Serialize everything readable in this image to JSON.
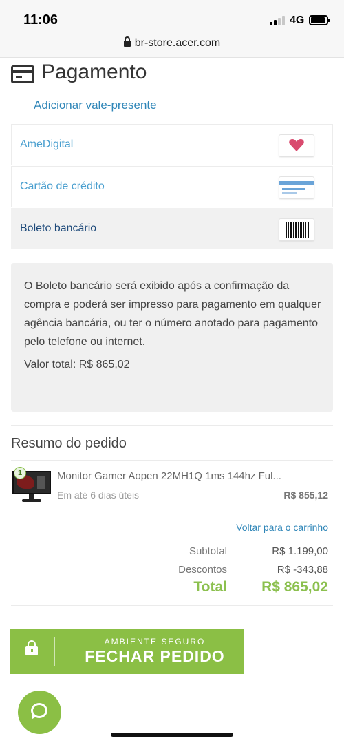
{
  "status_bar": {
    "time": "11:06",
    "network": "4G"
  },
  "browser": {
    "url": "br-store.acer.com"
  },
  "payment": {
    "title": "Pagamento",
    "gift_link": "Adicionar vale-presente",
    "options": [
      {
        "label": "AmeDigital",
        "icon": "heart-icon"
      },
      {
        "label": "Cartão de crédito",
        "icon": "credit-card-icon"
      },
      {
        "label": "Boleto bancário",
        "icon": "barcode-icon",
        "selected": true
      }
    ],
    "info_text": "O Boleto bancário será exibido após a confirmação da compra e poderá ser impresso para pagamento em qualquer agência bancária, ou ter o número anotado para pagamento pelo telefone ou internet.",
    "info_total": "Valor total: R$ 865,02"
  },
  "summary": {
    "title": "Resumo do pedido",
    "items": [
      {
        "quantity": "1",
        "name": "Monitor Gamer Aopen 22MH1Q 1ms 144hz Ful...",
        "delivery": "Em até 6 dias úteis",
        "price": "R$ 855,12"
      }
    ],
    "back_link": "Voltar para o carrinho",
    "subtotal_label": "Subtotal",
    "subtotal_value": "R$ 1.199,00",
    "discount_label": "Descontos",
    "discount_value": "R$ -343,88",
    "total_label": "Total",
    "total_value": "R$ 865,02"
  },
  "checkout": {
    "secure_label": "AMBIENTE SEGURO",
    "button_label": "FECHAR PEDIDO"
  },
  "colors": {
    "accent_green": "#8bbf45",
    "link_blue": "#2f86b8",
    "heart_pink": "#d94a6e"
  }
}
